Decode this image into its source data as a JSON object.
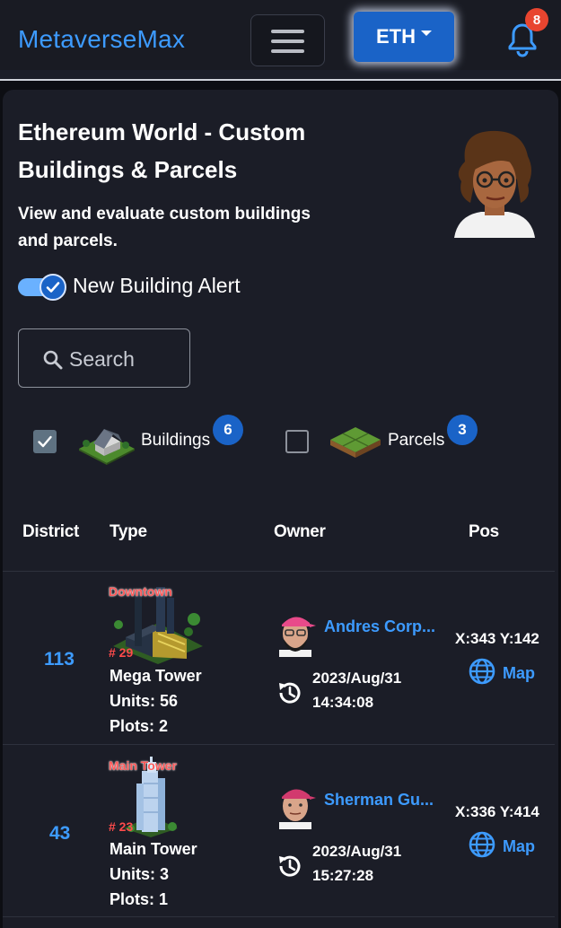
{
  "nav": {
    "brand": "MetaverseMax",
    "network_button": "ETH",
    "notification_count": "8",
    "icons": [
      "hamburger-icon",
      "bell-icon"
    ]
  },
  "header": {
    "title": "Ethereum World - Custom Buildings & Parcels",
    "subtitle": "View and evaluate custom buildings and parcels."
  },
  "alert_toggle": {
    "label": "New Building Alert",
    "checked": true
  },
  "search": {
    "placeholder": "Search",
    "value": ""
  },
  "filters": [
    {
      "label": "Buildings",
      "count": "6",
      "checked": true
    },
    {
      "label": "Parcels",
      "count": "3",
      "checked": false
    }
  ],
  "table": {
    "columns": [
      "District",
      "Type",
      "Owner",
      "Pos"
    ],
    "rows": [
      {
        "district": "113",
        "image_tag": "Downtown",
        "building_num": "# 29",
        "type": "Mega Tower",
        "units": "Units: 56",
        "plots": "Plots: 2",
        "owner": "Andres Corp...",
        "date": "2023/Aug/31",
        "time": "14:34:08",
        "pos": "X:343 Y:142",
        "map": "Map"
      },
      {
        "district": "43",
        "image_tag": "Main Tower",
        "building_num": "# 23",
        "type": "Main Tower",
        "units": "Units: 3",
        "plots": "Plots: 1",
        "owner": "Sherman Gu...",
        "date": "2023/Aug/31",
        "time": "15:27:28",
        "pos": "X:336 Y:414",
        "map": "Map"
      }
    ]
  },
  "colors": {
    "accent": "#3d9bff",
    "primary_button": "#1a63c7",
    "badge_red": "#e8452f",
    "background": "#0d0e13",
    "card": "#1b1d27"
  }
}
